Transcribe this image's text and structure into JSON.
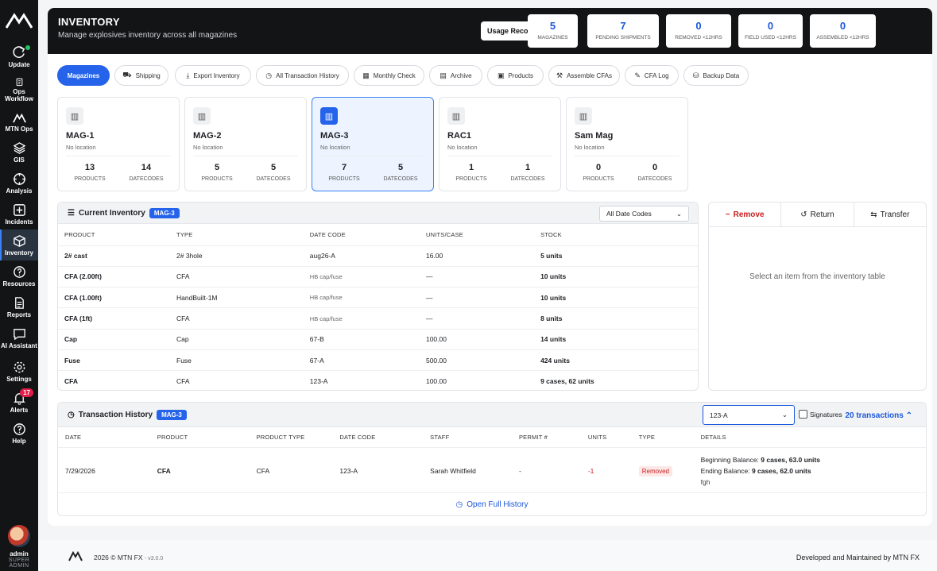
{
  "sidebar": {
    "items": [
      {
        "label": "Update",
        "icon": "refresh-icon"
      },
      {
        "label": "Ops Workflow",
        "icon": "clipboard-icon"
      },
      {
        "label": "MTN Ops",
        "icon": "mountain-icon"
      },
      {
        "label": "GIS",
        "icon": "layers-icon"
      },
      {
        "label": "Analysis",
        "icon": "crosshair-icon"
      },
      {
        "label": "Incidents",
        "icon": "plus-square-icon"
      },
      {
        "label": "Inventory",
        "icon": "cube-icon"
      },
      {
        "label": "Resources",
        "icon": "help-circle-icon"
      },
      {
        "label": "Reports",
        "icon": "document-icon"
      },
      {
        "label": "AI Assistant",
        "icon": "chat-icon"
      },
      {
        "label": "Settings",
        "icon": "gear-icon"
      },
      {
        "label": "Alerts",
        "icon": "bell-icon",
        "badge": "17"
      },
      {
        "label": "Help",
        "icon": "question-icon"
      }
    ],
    "user": {
      "name": "admin",
      "role": "SUPER ADMIN"
    }
  },
  "header": {
    "title": "INVENTORY",
    "subtitle": "Manage explosives inventory across all magazines",
    "reconcile_label": "Usage Reconciliation",
    "stats": [
      {
        "value": "5",
        "label": "Magazines"
      },
      {
        "value": "7",
        "label": "Pending Shipments"
      },
      {
        "value": "0",
        "label": "Removed <12hrs"
      },
      {
        "value": "0",
        "label": "Field Used <12hrs"
      },
      {
        "value": "0",
        "label": "Assembled <12hrs"
      }
    ]
  },
  "tabs": [
    {
      "label": "Magazines",
      "icon": "",
      "active": true
    },
    {
      "label": "Shipping",
      "icon": "⛟"
    },
    {
      "label": "Export Inventory",
      "icon": "⤓"
    },
    {
      "label": "All Transaction History",
      "icon": "◷"
    },
    {
      "label": "Monthly Check",
      "icon": "▦"
    },
    {
      "label": "Archive",
      "icon": "▤"
    },
    {
      "label": "Products",
      "icon": "▣"
    },
    {
      "label": "Assemble CFAs",
      "icon": "⚒"
    },
    {
      "label": "CFA Log",
      "icon": "✎"
    },
    {
      "label": "Backup Data",
      "icon": "⛁"
    }
  ],
  "magazines": [
    {
      "name": "MAG-1",
      "location": "No location",
      "products": "13",
      "datecodes": "14"
    },
    {
      "name": "MAG-2",
      "location": "No location",
      "products": "5",
      "datecodes": "5"
    },
    {
      "name": "MAG-3",
      "location": "No location",
      "products": "7",
      "datecodes": "5",
      "active": true
    },
    {
      "name": "RAC1",
      "location": "No location",
      "products": "1",
      "datecodes": "1"
    },
    {
      "name": "Sam Mag",
      "location": "No location",
      "products": "0",
      "datecodes": "0"
    }
  ],
  "mag_labels": {
    "products": "PRODUCTS",
    "datecodes": "DATECODES"
  },
  "inventory": {
    "title": "Current Inventory",
    "chip": "MAG-3",
    "filter": "All Date Codes",
    "columns": [
      "PRODUCT",
      "TYPE",
      "DATE CODE",
      "UNITS/CASE",
      "STOCK"
    ],
    "rows": [
      [
        "2# cast",
        "2# 3hole",
        "aug26-A",
        "16.00",
        "5 units"
      ],
      [
        "CFA (2.00ft)",
        "CFA",
        "HB cap/fuse",
        "—",
        "10 units"
      ],
      [
        "CFA (1.00ft)",
        "HandBuilt-1M",
        "HB cap/fuse",
        "—",
        "10 units"
      ],
      [
        "CFA (1ft)",
        "CFA",
        "HB cap/fuse",
        "—",
        "8 units"
      ],
      [
        "Cap",
        "Cap",
        "67-B",
        "100.00",
        "14 units"
      ],
      [
        "Fuse",
        "Fuse",
        "67-A",
        "500.00",
        "424 units"
      ],
      [
        "CFA",
        "CFA",
        "123-A",
        "100.00",
        "9 cases, 62 units"
      ]
    ]
  },
  "actions": {
    "remove": "Remove",
    "return": "Return",
    "transfer": "Transfer",
    "empty": "Select an item from the inventory table"
  },
  "history": {
    "title": "Transaction History",
    "chip": "MAG-3",
    "filter": "123-A",
    "signatures": "Signatures",
    "count": "20 transactions",
    "columns": [
      "DATE",
      "PRODUCT",
      "PRODUCT TYPE",
      "DATE CODE",
      "STAFF",
      "PERMIT #",
      "UNITS",
      "TYPE",
      "DETAILS"
    ],
    "row": {
      "date": "7/29/2026",
      "product": "CFA",
      "type": "CFA",
      "datecode": "123-A",
      "staff": "Sarah Whitfield",
      "permit": "-",
      "units": "-1",
      "kind": "Removed",
      "begin_label": "Beginning Balance:",
      "begin_value": "9 cases, 63.0 units",
      "end_label": "Ending Balance:",
      "end_value": "9 cases, 62.0 units",
      "note": "fgh"
    },
    "open_full": "Open Full History"
  },
  "footer": {
    "copyright": "2026 © MTN FX",
    "version": "- v3.0.0",
    "developer": "Developed and Maintained by MTN FX"
  }
}
